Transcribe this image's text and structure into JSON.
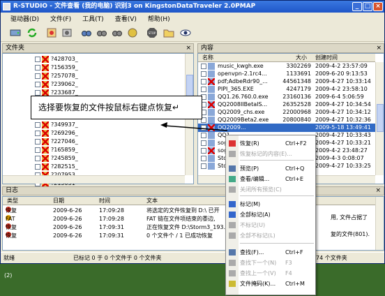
{
  "window": {
    "title": "R-STUDIO - 文件查看 (我的电脑) 识别3 on KingstonDataTraveler 2.0PMAP"
  },
  "menu": [
    "驱动器(D)",
    "文件(F)",
    "工具(T)",
    "查看(V)",
    "帮助(H)"
  ],
  "toolbar": {
    "icons": [
      "drive-icon",
      "refresh-icon",
      "recover-icon",
      "recover-marked-icon",
      "find-icon",
      "find-next-icon",
      "find-prev-icon",
      "mask-icon",
      "stop-icon",
      "folder-icon",
      "view-icon"
    ]
  },
  "left_pane": {
    "title": "文件夹",
    "items": [
      "?428703_",
      "?156359_",
      "?257078_",
      "?239062_",
      "?233687_",
      "?349937_",
      "?269296_",
      "?227046_",
      "?165859_",
      "?245859_",
      "?282515_",
      "?207953_",
      "?215031"
    ]
  },
  "right_pane": {
    "title": "内容",
    "columns": {
      "name": "名称",
      "size": "大小",
      "created": "创建时间"
    },
    "rows": [
      {
        "name": "music_kwgh.exe",
        "size": "3302269",
        "date": "2009-4-2 23:57:09"
      },
      {
        "name": "openvpn-2.1rc4...",
        "size": "1133691",
        "date": "2009-6-20 9:13:53"
      },
      {
        "name": "pdf;AdbeRdr90_...",
        "size": "44561348",
        "date": "2009-4-27 10:33:14"
      },
      {
        "name": "PIPI_365.EXE",
        "size": "4247179",
        "date": "2009-4-2 23:58:10"
      },
      {
        "name": "QQ1.26.760.0.exe",
        "size": "23160136",
        "date": "2009-6-4 5:06:59"
      },
      {
        "name": "QQ2008IIBetaIS...",
        "size": "26352528",
        "date": "2009-4-27 10:34:54"
      },
      {
        "name": "QQ2009_chs.exe",
        "size": "22000968",
        "date": "2009-4-27 10:34:12"
      },
      {
        "name": "QQ2009Beta2.exe",
        "size": "20800840",
        "date": "2009-4-27 10:32:36"
      },
      {
        "name": "QQ2009...",
        "size": "",
        "date": "2009-5-18 13:49:41"
      },
      {
        "name": "QQ1...",
        "size": "",
        "date": "2009-4-27 10:33:43"
      },
      {
        "name": "sog...",
        "size": "",
        "date": "2009-4-27 10:33:21"
      },
      {
        "name": "sog...",
        "size": "",
        "date": "2009-4-2 23:48:27"
      },
      {
        "name": "Sto...",
        "size": "",
        "date": "2009-4-3 0:08:07"
      },
      {
        "name": "Sto...",
        "size": "",
        "date": "2009-4-27 10:33:25"
      }
    ]
  },
  "callout": {
    "text": "选择要恢复的文件按鼠标右键点恢复↵"
  },
  "context_menu": {
    "items": [
      {
        "label": "恢复(R)",
        "shortcut": "Ctrl+F2",
        "disabled": false
      },
      {
        "label": "恢复标记的内容(E)...",
        "shortcut": "",
        "disabled": true
      },
      {
        "label": "预览(P)",
        "shortcut": "Ctrl+Q",
        "disabled": false
      },
      {
        "label": "查看/编辑...",
        "shortcut": "Ctrl+E",
        "disabled": false
      },
      {
        "label": "关闭所有预览(C)",
        "shortcut": "",
        "disabled": true
      },
      {
        "label": "标记(M)",
        "shortcut": "",
        "disabled": false
      },
      {
        "label": "全部标记(A)",
        "shortcut": "",
        "disabled": false
      },
      {
        "label": "不标记(U)",
        "shortcut": "",
        "disabled": true
      },
      {
        "label": "全部不标记(L)",
        "shortcut": "",
        "disabled": true
      },
      {
        "label": "查找(F)...",
        "shortcut": "Ctrl+F",
        "disabled": false
      },
      {
        "label": "查找下一个(N)",
        "shortcut": "F3",
        "disabled": true
      },
      {
        "label": "查找上一个(V)",
        "shortcut": "F4",
        "disabled": true
      },
      {
        "label": "文件掩码(K)...",
        "shortcut": "Ctrl+M",
        "disabled": false
      }
    ]
  },
  "log": {
    "title": "日志",
    "columns": {
      "type": "类型",
      "date": "日期",
      "time": "时间",
      "text": "文本"
    },
    "rows": [
      {
        "type": "恢复",
        "date": "2009-6-26",
        "time": "17:09:28",
        "text": "将选定的文件恢复到 D:\\ 已开",
        "color": "#d03020"
      },
      {
        "type": "FAT",
        "date": "2009-6-26",
        "time": "17:09:28",
        "text": "FAT 链在文件项结束的黍边,",
        "color": "#e0a000"
      },
      {
        "type": "恢复",
        "date": "2009-6-26",
        "time": "17:09:31",
        "text": "正在恢复文件 D:\\Storm3_193.",
        "color": "#d03020"
      },
      {
        "type": "恢复",
        "date": "2009-6-26",
        "time": "17:09:31",
        "text": "0 个文件个 / 1 已成功恢复",
        "color": "#d03020"
      }
    ],
    "right_text": [
      "用, 文件占据了",
      "复的文件(801)."
    ]
  },
  "status": {
    "ready": "就绪",
    "marked": "已标记 0 于 0 个文件于 0 个文件夹",
    "right": "74 个文件夹"
  },
  "desktop": {
    "label": "(2)"
  }
}
